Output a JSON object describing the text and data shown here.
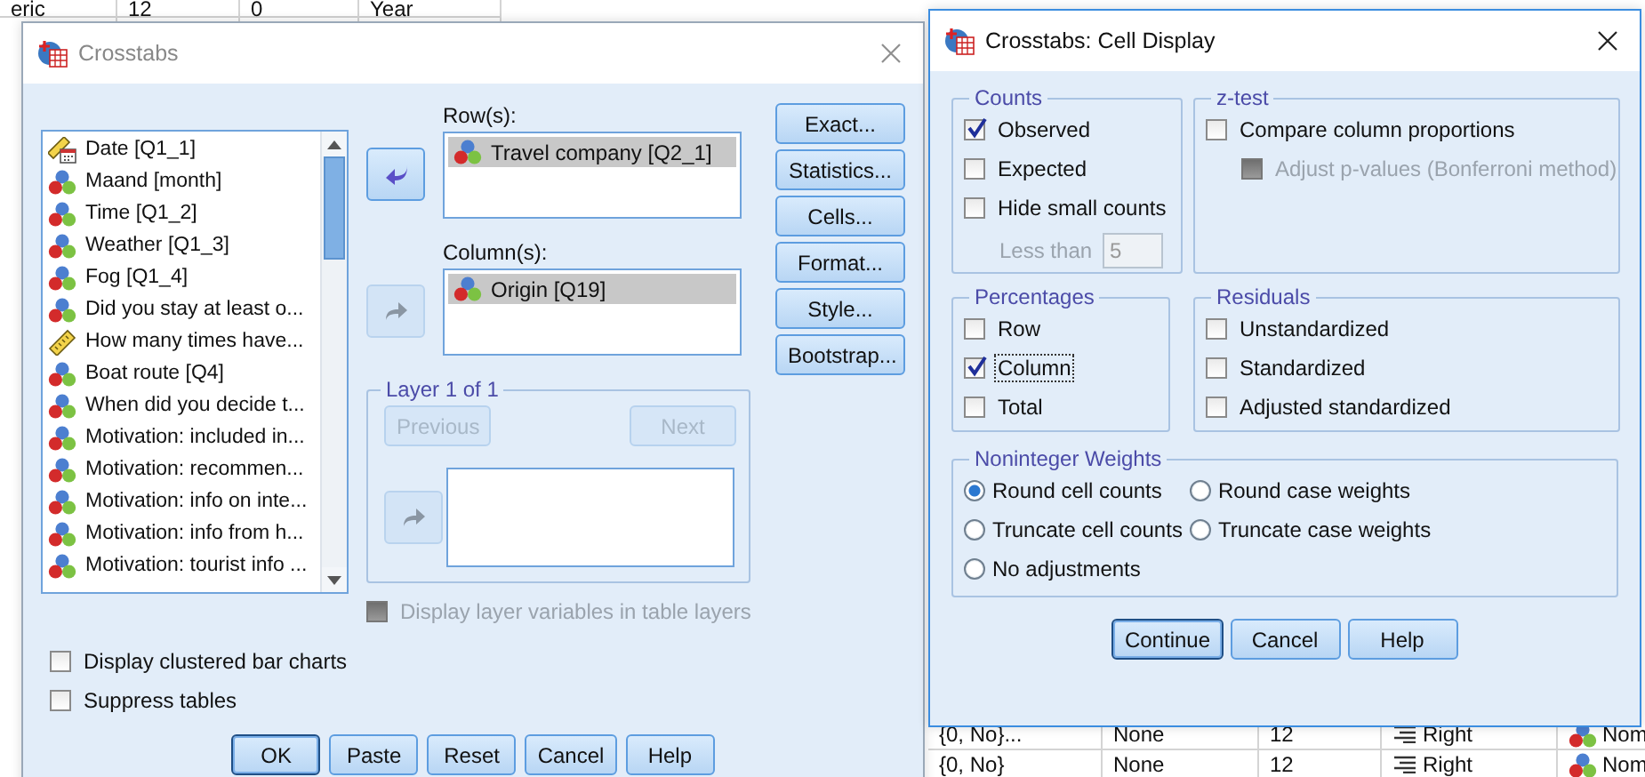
{
  "background_sheet": {
    "top_cells": [
      "eric",
      "12",
      "0",
      "Year"
    ],
    "bottom_rows": [
      [
        {
          "text": "{0, No}...",
          "kind": "plain"
        },
        {
          "text": "None",
          "kind": "plain"
        },
        {
          "text": "12",
          "kind": "plain"
        },
        {
          "text": "Right",
          "kind": "alignment"
        },
        {
          "text": "Nom",
          "kind": "measure"
        }
      ],
      [
        {
          "text": "{0, No}",
          "kind": "plain"
        },
        {
          "text": "None",
          "kind": "plain"
        },
        {
          "text": "12",
          "kind": "plain"
        },
        {
          "text": "Right",
          "kind": "alignment"
        },
        {
          "text": "Nom",
          "kind": "measure"
        }
      ]
    ]
  },
  "crosstabs": {
    "title": "Crosstabs",
    "variables": [
      {
        "label": "Date [Q1_1]",
        "kind": "date"
      },
      {
        "label": "Maand [month]",
        "kind": "nominal"
      },
      {
        "label": "Time [Q1_2]",
        "kind": "nominal"
      },
      {
        "label": "Weather [Q1_3]",
        "kind": "nominal"
      },
      {
        "label": "Fog [Q1_4]",
        "kind": "nominal"
      },
      {
        "label": "Did you stay at least o...",
        "kind": "nominal"
      },
      {
        "label": "How many times have...",
        "kind": "scale"
      },
      {
        "label": "Boat route [Q4]",
        "kind": "nominal"
      },
      {
        "label": "When did you decide t...",
        "kind": "nominal"
      },
      {
        "label": "Motivation: included in...",
        "kind": "nominal"
      },
      {
        "label": "Motivation: recommen...",
        "kind": "nominal"
      },
      {
        "label": "Motivation: info on inte...",
        "kind": "nominal"
      },
      {
        "label": "Motivation: info from h...",
        "kind": "nominal"
      },
      {
        "label": "Motivation: tourist info ...",
        "kind": "nominal"
      }
    ],
    "row_label": "Row(s):",
    "rows": [
      {
        "label": "Travel company [Q2_1]",
        "kind": "nominal"
      }
    ],
    "column_label": "Column(s):",
    "columns": [
      {
        "label": "Origin [Q19]",
        "kind": "nominal"
      }
    ],
    "move_buttons": [
      {
        "kind": "left",
        "disabled": false
      },
      {
        "kind": "right",
        "disabled": true
      },
      {
        "kind": "right",
        "disabled": true
      }
    ],
    "layer": {
      "title": "Layer 1 of 1",
      "buttons": [
        {
          "label": "Previous",
          "disabled": true
        },
        {
          "label": "Next",
          "disabled": true
        }
      ]
    },
    "layer_option": {
      "label": "Display layer variables in table layers",
      "checked": false,
      "disabled": true
    },
    "side_buttons": [
      "Exact...",
      "Statistics...",
      "Cells...",
      "Format...",
      "Style...",
      "Bootstrap..."
    ],
    "options": [
      {
        "label": "Display clustered bar charts",
        "checked": false
      },
      {
        "label": "Suppress tables",
        "checked": false
      }
    ],
    "buttons": [
      {
        "label": "OK",
        "default": true
      },
      {
        "label": "Paste",
        "default": false
      },
      {
        "label": "Reset",
        "default": false
      },
      {
        "label": "Cancel",
        "default": false
      },
      {
        "label": "Help",
        "default": false
      }
    ]
  },
  "cell_display": {
    "title": "Crosstabs: Cell Display",
    "groups": [
      {
        "title": "Counts",
        "items": [
          {
            "kind": "checkbox",
            "label": "Observed",
            "checked": true,
            "disabled": false,
            "focused": false
          },
          {
            "kind": "checkbox",
            "label": "Expected",
            "checked": false,
            "disabled": false,
            "focused": false
          },
          {
            "kind": "checkbox",
            "label": "Hide small counts",
            "checked": false,
            "disabled": false,
            "focused": false
          },
          {
            "kind": "field",
            "label": "Less than",
            "value": "5",
            "disabled": true
          }
        ]
      },
      {
        "title": "z-test",
        "items": [
          {
            "kind": "checkbox",
            "label": "Compare column proportions",
            "checked": false,
            "disabled": false,
            "focused": false
          },
          {
            "kind": "subcheckbox",
            "label": "Adjust p-values (Bonferroni method)",
            "checked": false,
            "disabled": true,
            "focused": false
          }
        ]
      },
      {
        "title": "Percentages",
        "items": [
          {
            "kind": "checkbox",
            "label": "Row",
            "checked": false,
            "disabled": false,
            "focused": false
          },
          {
            "kind": "checkbox",
            "label": "Column",
            "checked": true,
            "disabled": false,
            "focused": true
          },
          {
            "kind": "checkbox",
            "label": "Total",
            "checked": false,
            "disabled": false,
            "focused": false
          }
        ]
      },
      {
        "title": "Residuals",
        "items": [
          {
            "kind": "checkbox",
            "label": "Unstandardized",
            "checked": false,
            "disabled": false,
            "focused": false
          },
          {
            "kind": "checkbox",
            "label": "Standardized",
            "checked": false,
            "disabled": false,
            "focused": false
          },
          {
            "kind": "checkbox",
            "label": "Adjusted standardized",
            "checked": false,
            "disabled": false,
            "focused": false
          }
        ]
      }
    ],
    "weights": {
      "title": "Noninteger Weights",
      "options": [
        {
          "label": "Round cell counts",
          "selected": true
        },
        {
          "label": "Round case weights",
          "selected": false
        },
        {
          "label": "Truncate cell counts",
          "selected": false
        },
        {
          "label": "Truncate case weights",
          "selected": false
        },
        {
          "label": "No adjustments",
          "selected": false
        }
      ]
    },
    "buttons": [
      {
        "label": "Continue",
        "default": true
      },
      {
        "label": "Cancel",
        "default": false
      },
      {
        "label": "Help",
        "default": false
      }
    ]
  }
}
